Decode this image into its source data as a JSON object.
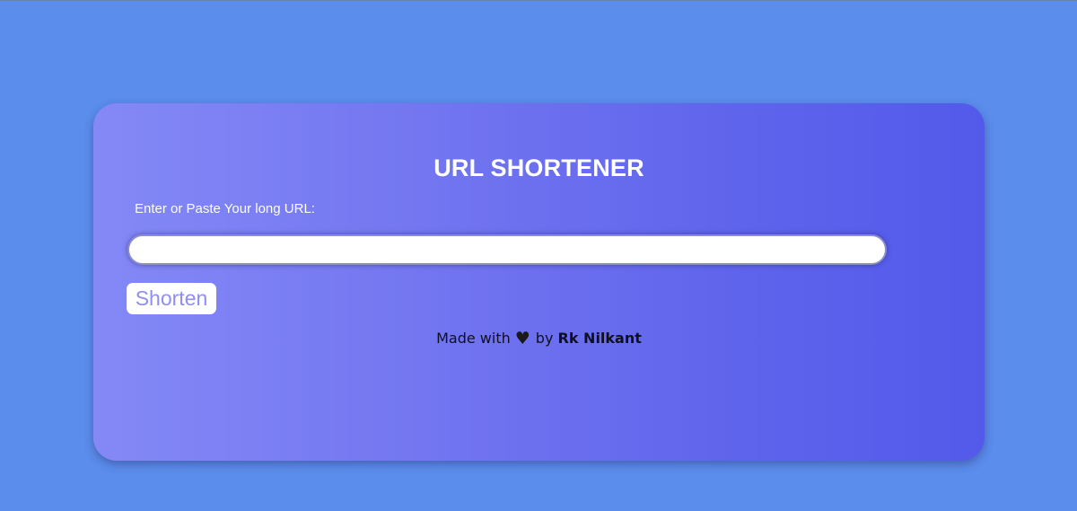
{
  "app": {
    "title": "URL SHORTENER"
  },
  "form": {
    "label": "Enter or Paste Your long URL:",
    "input_value": "",
    "input_placeholder": "",
    "button_label": "Shorten"
  },
  "footer": {
    "made_with": "Made with",
    "heart_icon": "heart-icon",
    "by": "by",
    "author": "Rk Nilkant"
  },
  "colors": {
    "page_background": "#5b8ded",
    "card_gradient_start": "#8489f6",
    "card_gradient_end": "#535aea",
    "button_text": "#8e8ff0"
  }
}
